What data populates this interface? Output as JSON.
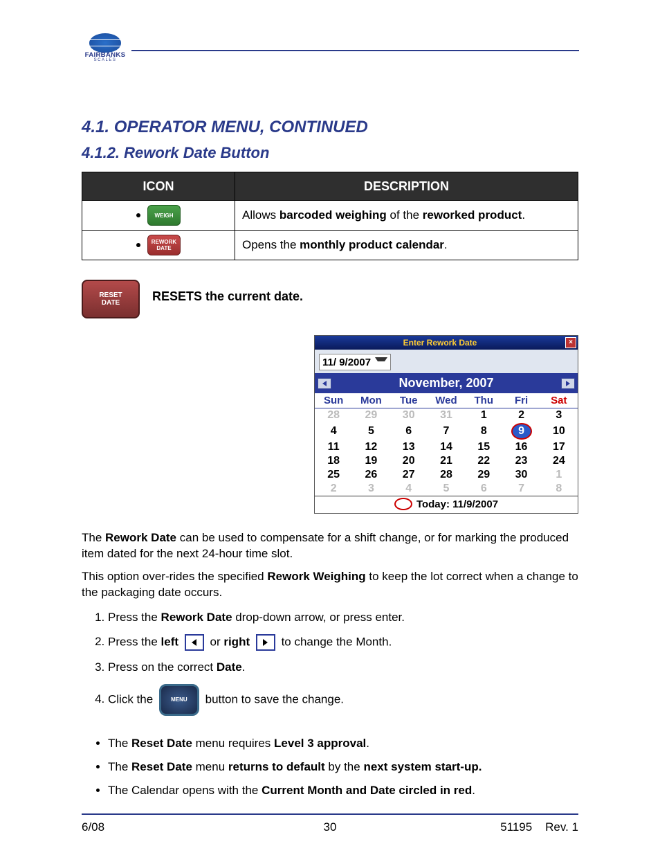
{
  "logo": {
    "brand": "FAIRBANKS",
    "sub": "SCALES"
  },
  "section_title": "4.1. OPERATOR MENU, CONTINUED",
  "section_sub": "4.1.2. Rework Date Button",
  "icon_table": {
    "headers": [
      "ICON",
      "DESCRIPTION"
    ],
    "rows": [
      {
        "icon": {
          "type": "green",
          "text": "WEIGH"
        },
        "desc_parts": [
          "Allows ",
          "barcoded weighing",
          " of the ",
          "reworked product",
          "."
        ],
        "bold_idx": [
          1,
          3
        ]
      },
      {
        "icon": {
          "type": "red",
          "text": "REWORK DATE"
        },
        "desc_parts": [
          "Opens the ",
          "monthly product calendar",
          "."
        ],
        "bold_idx": [
          1
        ]
      }
    ]
  },
  "reset": {
    "btn_text": "RESET DATE",
    "caption": "RESETS the current date."
  },
  "calendar": {
    "title": "Enter Rework Date",
    "date_value": "11/ 9/2007",
    "month_label": "November, 2007",
    "day_headers": [
      "Sun",
      "Mon",
      "Tue",
      "Wed",
      "Thu",
      "Fri",
      "Sat"
    ],
    "weeks": [
      [
        {
          "d": 28,
          "dim": true
        },
        {
          "d": 29,
          "dim": true
        },
        {
          "d": 30,
          "dim": true
        },
        {
          "d": 31,
          "dim": true
        },
        {
          "d": 1
        },
        {
          "d": 2
        },
        {
          "d": 3
        }
      ],
      [
        {
          "d": 4
        },
        {
          "d": 5
        },
        {
          "d": 6
        },
        {
          "d": 7
        },
        {
          "d": 8
        },
        {
          "d": 9,
          "sel": true
        },
        {
          "d": 10
        }
      ],
      [
        {
          "d": 11
        },
        {
          "d": 12
        },
        {
          "d": 13
        },
        {
          "d": 14
        },
        {
          "d": 15
        },
        {
          "d": 16
        },
        {
          "d": 17
        }
      ],
      [
        {
          "d": 18
        },
        {
          "d": 19
        },
        {
          "d": 20
        },
        {
          "d": 21
        },
        {
          "d": 22
        },
        {
          "d": 23
        },
        {
          "d": 24
        }
      ],
      [
        {
          "d": 25
        },
        {
          "d": 26
        },
        {
          "d": 27
        },
        {
          "d": 28
        },
        {
          "d": 29
        },
        {
          "d": 30
        },
        {
          "d": 1,
          "dim": true
        }
      ],
      [
        {
          "d": 2,
          "dim": true
        },
        {
          "d": 3,
          "dim": true
        },
        {
          "d": 4,
          "dim": true
        },
        {
          "d": 5,
          "dim": true
        },
        {
          "d": 6,
          "dim": true
        },
        {
          "d": 7,
          "dim": true
        },
        {
          "d": 8,
          "dim": true
        }
      ]
    ],
    "today_label": "Today: 11/9/2007"
  },
  "para1_parts": [
    "The ",
    "Rework Date",
    " can be used to compensate for a shift change, or for marking the produced item dated for the next 24-hour time slot."
  ],
  "para2_parts": [
    "This option over-rides the specified ",
    "Rework Weighing",
    " to keep the lot correct when a change to the packaging date occurs."
  ],
  "steps": {
    "s1": [
      "Press the ",
      "Rework Date",
      " drop-down arrow, or press enter."
    ],
    "s2": [
      "Press the ",
      "left",
      "  or ",
      "right",
      "  to change the Month."
    ],
    "s3": [
      "Press on the correct ",
      "Date",
      "."
    ],
    "s4": [
      "Click the ",
      " button to save the change."
    ]
  },
  "notes": {
    "n1": [
      "The ",
      "Reset Date",
      " menu requires ",
      "Level 3 approval",
      "."
    ],
    "n2": [
      "The ",
      "Reset Date",
      " menu ",
      "returns to default",
      " by the ",
      "next system start-up."
    ],
    "n3": [
      "The Calendar opens with the ",
      "Current Month and Date circled in red",
      "."
    ]
  },
  "menu_btn_text": "MENU",
  "footer": {
    "left": "6/08",
    "center": "30",
    "right_code": "51195",
    "right_rev": "Rev. 1"
  }
}
